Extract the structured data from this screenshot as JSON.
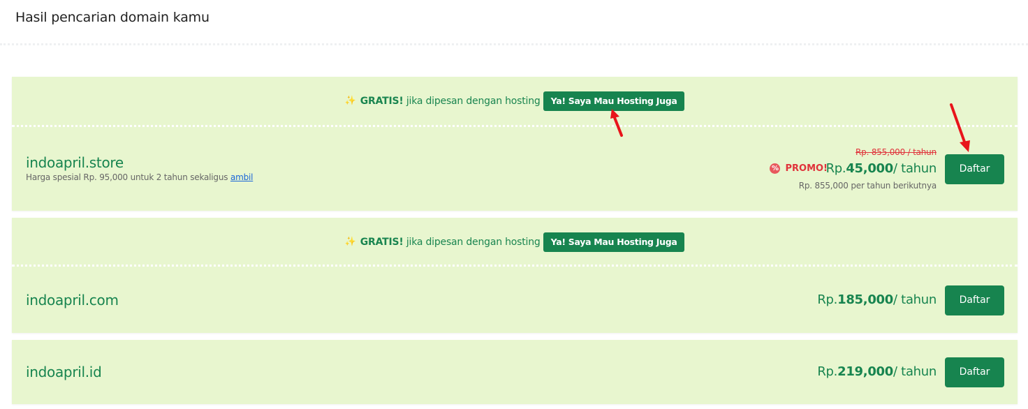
{
  "page": {
    "title": "Hasil pencarian domain kamu"
  },
  "promo_strip": {
    "gratis": "GRATIS!",
    "text": " jika dipesan dengan hosting",
    "button": "Ya! Saya Mau Hosting Juga"
  },
  "results": [
    {
      "domain": "indoapril.store",
      "note": "Harga spesial Rp. 95,000 untuk 2 tahun sekaligus",
      "note_link": "ambil",
      "old_price": "Rp. 855,000 / tahun",
      "promo_label": "PROMO!",
      "price_prefix": "Rp.",
      "price_amount": "45,000",
      "price_unit": "/ tahun",
      "next_price": "Rp. 855,000 per tahun berikutnya",
      "button": "Daftar"
    },
    {
      "domain": "indoapril.com",
      "price_prefix": "Rp.",
      "price_amount": "185,000",
      "price_unit": "/ tahun",
      "button": "Daftar"
    },
    {
      "domain": "indoapril.id",
      "price_prefix": "Rp.",
      "price_amount": "219,000",
      "price_unit": "/ tahun",
      "button": "Daftar"
    }
  ],
  "colors": {
    "brand_green": "#17844f",
    "card_bg": "#e8f6cf",
    "promo_red": "#e0333b",
    "annotation_arrow": "#e8151b"
  },
  "icons": {
    "sparkle": "sparkle-icon",
    "promo": "percent-badge-icon"
  }
}
